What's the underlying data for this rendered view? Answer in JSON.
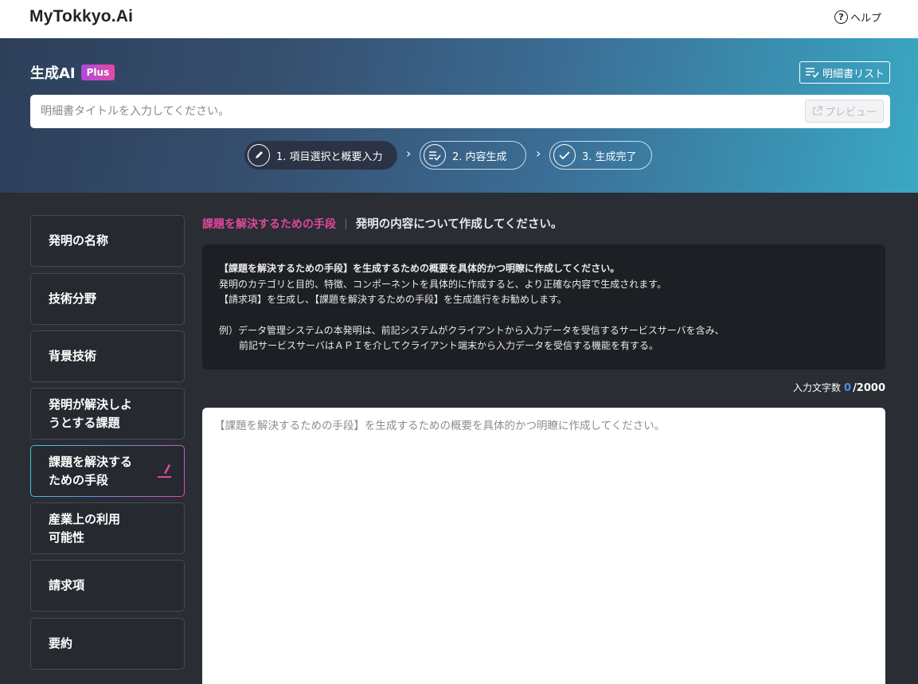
{
  "app": {
    "logo": "MyTokkyo.Ai",
    "help_label": "ヘルプ"
  },
  "hero": {
    "title": "生成AI",
    "badge": "Plus",
    "spec_list_label": "明細書リスト",
    "title_placeholder": "明細書タイトルを入力してください。",
    "preview_label": "プレビュー"
  },
  "steps": [
    {
      "label": "1. 項目選択と概要入力",
      "icon": "pencil-icon",
      "state": "active"
    },
    {
      "label": "2. 内容生成",
      "icon": "list-check-icon",
      "state": "inactive"
    },
    {
      "label": "3. 生成完了",
      "icon": "check-icon",
      "state": "inactive"
    }
  ],
  "sidebar": {
    "items": [
      {
        "line1": "発明の名称",
        "line2": ""
      },
      {
        "line1": "技術分野",
        "line2": ""
      },
      {
        "line1": "背景技術",
        "line2": ""
      },
      {
        "line1": "発明が解決しよ",
        "line2": "うとする課題"
      },
      {
        "line1": "課題を解決する",
        "line2": "ための手段",
        "active": true
      },
      {
        "line1": "産業上の利用",
        "line2": "可能性"
      },
      {
        "line1": "請求項",
        "line2": ""
      },
      {
        "line1": "要約",
        "line2": ""
      }
    ]
  },
  "main": {
    "section_name": "課題を解決するための手段",
    "separator": "|",
    "instruction": "発明の内容について作成してください。",
    "guide": {
      "line1": "【課題を解決するための手段】を生成するための概要を具体的かつ明瞭に作成してください。",
      "line2": "発明のカテゴリと目的、特徴、コンポーネントを具体的に作成すると、より正確な内容で生成されます。",
      "line3": "【請求項】を生成し、【課題を解決するための手段】を生成進行をお勧めします。",
      "example1": "例）データ管理システムの本発明は、前記システムがクライアントから入力データを受信するサービスサーバを含み、",
      "example2": "前記サービスサーバはＡＰＩを介してクライアント端末から入力データを受信する機能を有する。"
    },
    "counter": {
      "label": "入力文字数",
      "current": "0",
      "max": "/2000"
    },
    "textarea_placeholder": "【課題を解決するための手段】を生成するための概要を具体的かつ明瞭に作成してください。"
  },
  "colors": {
    "accent_pink": "#e0489c",
    "counter_blue": "#4a8de8",
    "bg_dark": "#2a2d33"
  }
}
